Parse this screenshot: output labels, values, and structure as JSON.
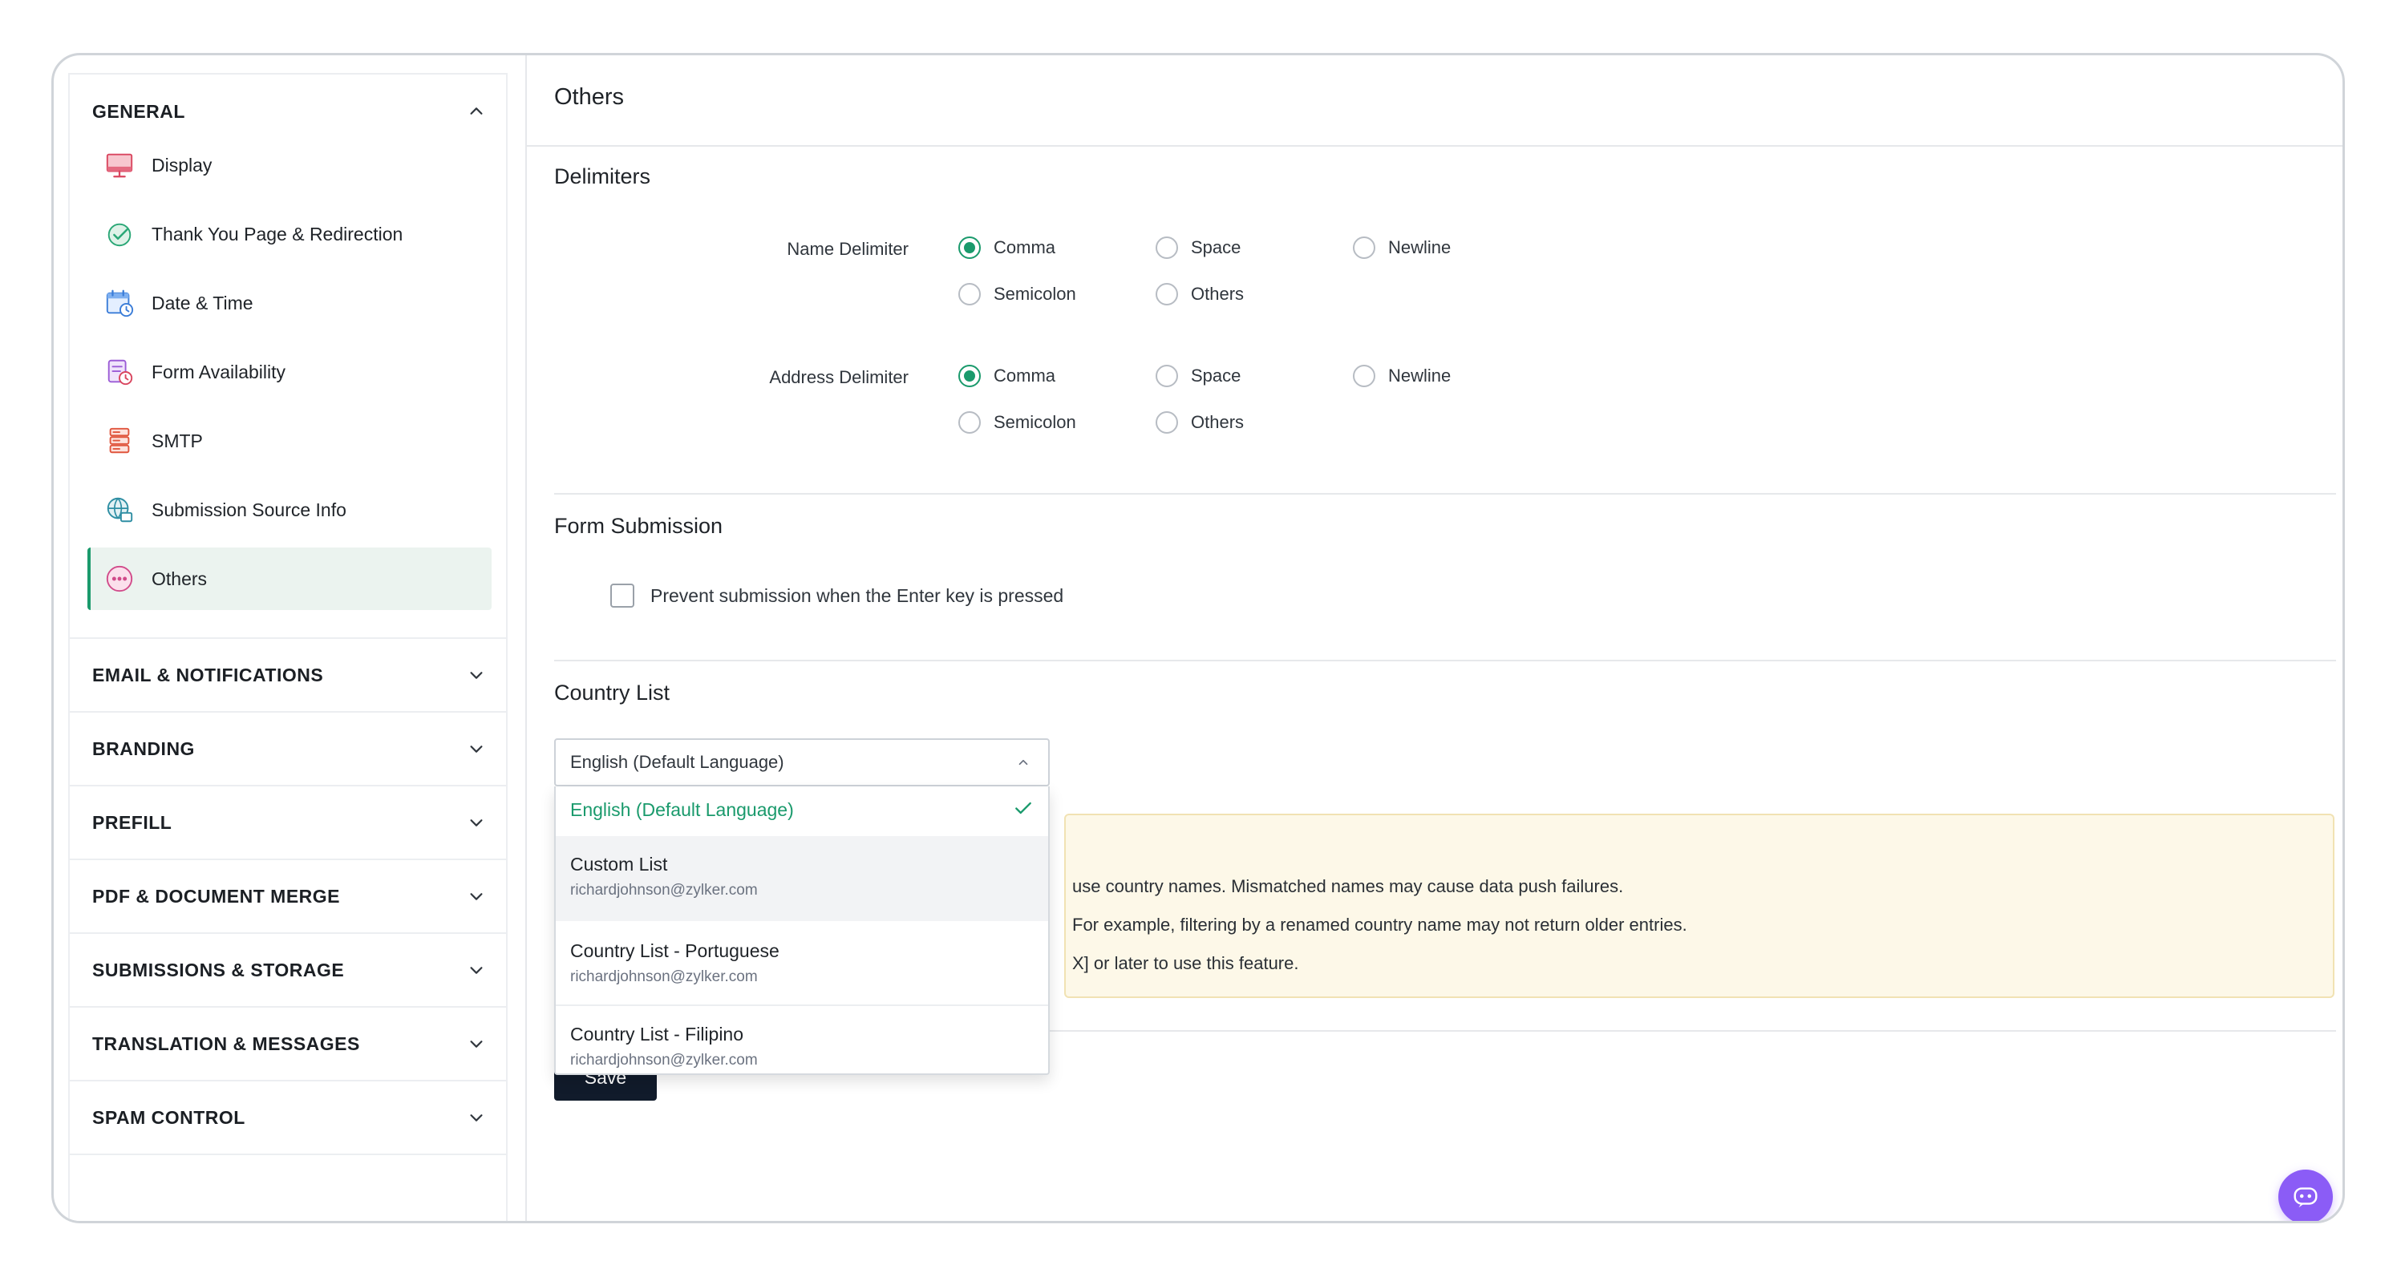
{
  "sidebar": {
    "general": {
      "title": "GENERAL",
      "items": [
        {
          "label": "Display",
          "icon": "display-monitor-icon"
        },
        {
          "label": "Thank You Page & Redirection",
          "icon": "check-circle-icon"
        },
        {
          "label": "Date & Time",
          "icon": "calendar-clock-icon"
        },
        {
          "label": "Form Availability",
          "icon": "form-clock-icon"
        },
        {
          "label": "SMTP",
          "icon": "server-icon"
        },
        {
          "label": "Submission Source Info",
          "icon": "globe-icon"
        },
        {
          "label": "Others",
          "icon": "more-dots-icon"
        }
      ],
      "active_item": "Others"
    },
    "sections": [
      {
        "title": "EMAIL & NOTIFICATIONS"
      },
      {
        "title": "BRANDING"
      },
      {
        "title": "PREFILL"
      },
      {
        "title": "PDF & DOCUMENT MERGE"
      },
      {
        "title": "SUBMISSIONS & STORAGE"
      },
      {
        "title": "TRANSLATION & MESSAGES"
      },
      {
        "title": "SPAM CONTROL"
      }
    ]
  },
  "main": {
    "title": "Others",
    "delimiters": {
      "heading": "Delimiters",
      "name_label": "Name Delimiter",
      "address_label": "Address Delimiter",
      "options": [
        "Comma",
        "Space",
        "Newline",
        "Semicolon",
        "Others"
      ],
      "name_selected": "Comma",
      "address_selected": "Comma"
    },
    "form_submission": {
      "heading": "Form Submission",
      "checkbox_label": "Prevent submission when the Enter key is pressed",
      "checked": false
    },
    "country_list": {
      "heading": "Country List",
      "selected": "English (Default Language)",
      "options": [
        {
          "label": "English (Default Language)",
          "sub": ""
        },
        {
          "label": "Custom List",
          "sub": "richardjohnson@zylker.com"
        },
        {
          "label": "Country List - Portuguese",
          "sub": "richardjohnson@zylker.com"
        },
        {
          "label": "Country List - Filipino",
          "sub": "richardjohnson@zylker.com"
        }
      ]
    },
    "notice_lines": [
      "use country names. Mismatched names may cause data push failures.",
      "For example, filtering by a renamed country name may not return older entries.",
      "X] or later to use this feature."
    ],
    "save_label": "Save"
  },
  "colors": {
    "accent": "#1a9a6c",
    "primary_button": "#111b2b",
    "notice_bg": "#fdf8e8",
    "chat_fab": "#8b5cf6"
  }
}
